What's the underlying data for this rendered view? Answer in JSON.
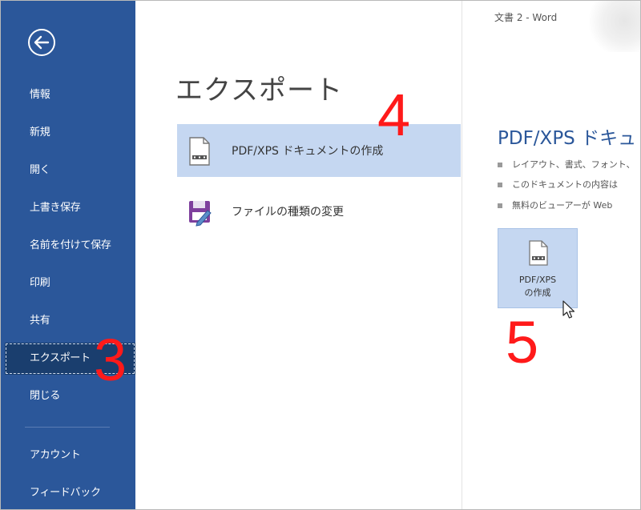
{
  "window": {
    "title": "文書 2 - Word"
  },
  "sidebar": {
    "items": [
      {
        "label": "情報"
      },
      {
        "label": "新規"
      },
      {
        "label": "開く"
      },
      {
        "label": "上書き保存"
      },
      {
        "label": "名前を付けて保存"
      },
      {
        "label": "印刷"
      },
      {
        "label": "共有"
      },
      {
        "label": "エクスポート",
        "selected": true
      },
      {
        "label": "閉じる"
      },
      {
        "label": "アカウント"
      },
      {
        "label": "フィードバック"
      }
    ]
  },
  "main": {
    "heading": "エクスポート",
    "options": [
      {
        "label": "PDF/XPS ドキュメントの作成",
        "icon": "pdf-document-icon",
        "selected": true
      },
      {
        "label": "ファイルの種類の変更",
        "icon": "save-as-icon",
        "selected": false
      }
    ]
  },
  "detail": {
    "heading": "PDF/XPS ドキュ",
    "bullets": [
      "レイアウト、書式、フォント、",
      "このドキュメントの内容は",
      "無料のビューアーが Web"
    ],
    "button": {
      "line1": "PDF/XPS",
      "line2": "の作成"
    }
  },
  "annotations": {
    "step3": "3",
    "step4": "4",
    "step5": "5"
  },
  "colors": {
    "sidebar": "#2b579a",
    "selected_option": "#c5d7f1",
    "accent": "#2b579a",
    "annotation": "#ff1a1a"
  }
}
